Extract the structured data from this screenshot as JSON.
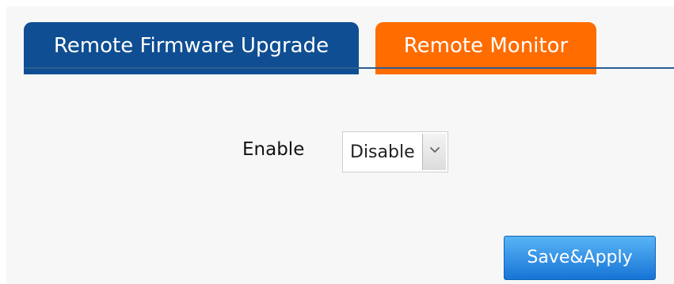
{
  "tabs": [
    {
      "label": "Remote Firmware Upgrade",
      "color": "#0f4e92",
      "active": false
    },
    {
      "label": "Remote Monitor",
      "color": "#ff6c00",
      "active": true
    }
  ],
  "form": {
    "enable_label": "Enable",
    "enable_select": {
      "value": "Disable"
    }
  },
  "actions": {
    "save_apply_label": "Save&Apply"
  },
  "icons": {
    "dropdown": "chevron-down-icon"
  }
}
